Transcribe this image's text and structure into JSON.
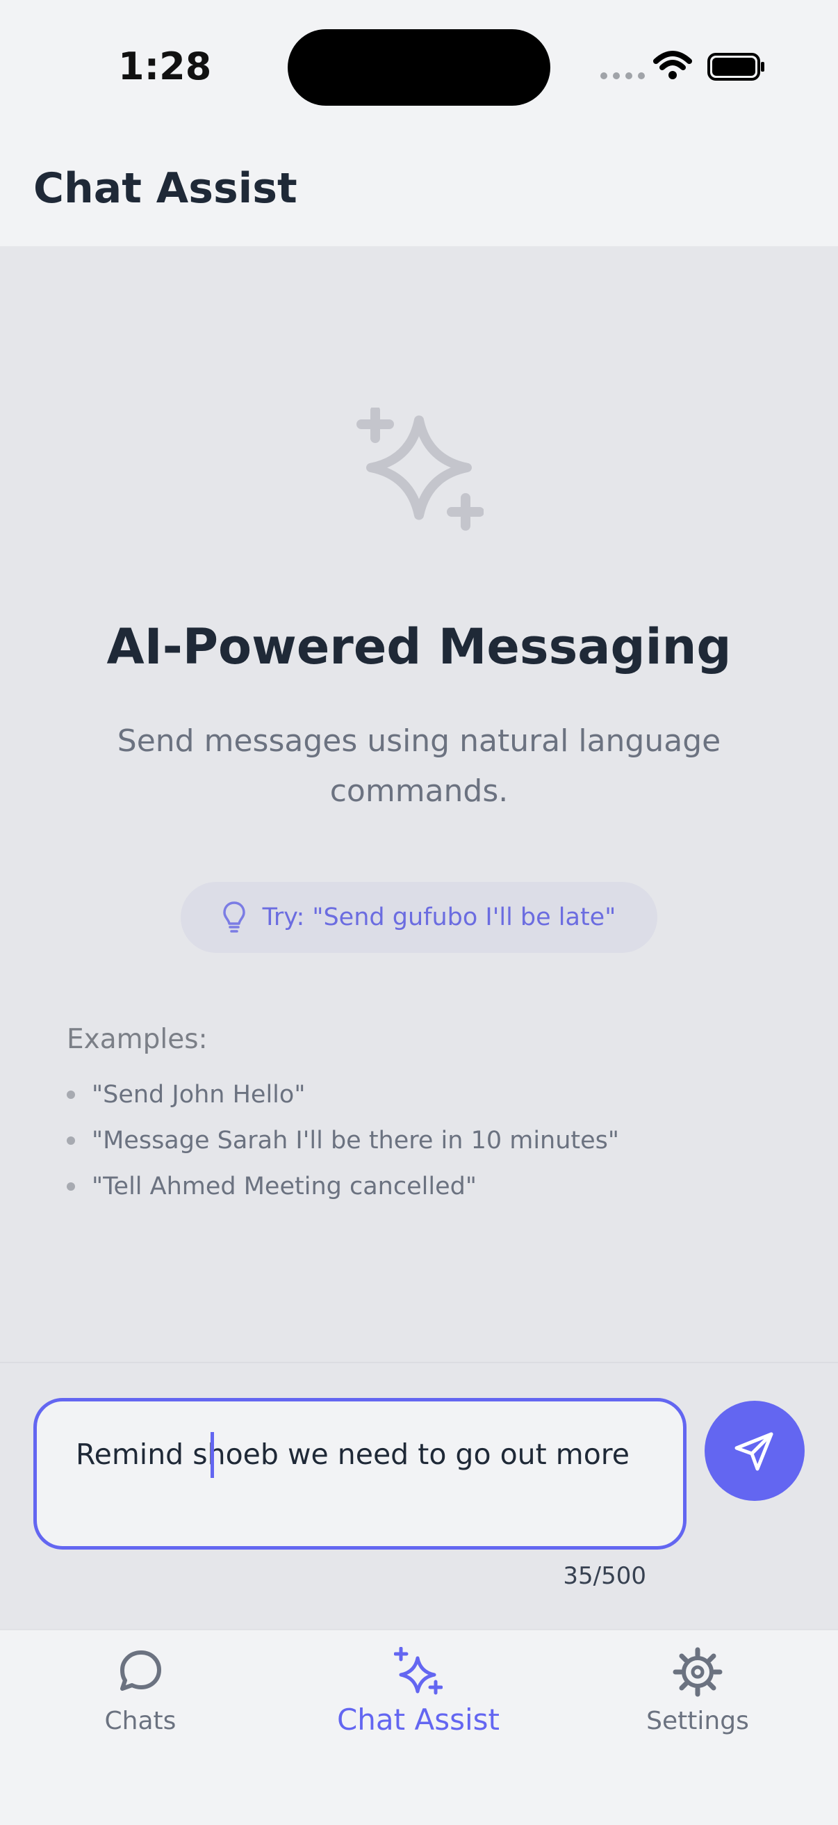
{
  "status_bar": {
    "time": "1:28"
  },
  "header": {
    "title": "Chat Assist"
  },
  "hero": {
    "icon": "sparkles-icon",
    "title": "AI-Powered Messaging",
    "subtitle": "Send messages using natural language commands."
  },
  "tip": {
    "icon": "lightbulb-icon",
    "text": "Try: \"Send gufubo I'll be late\""
  },
  "examples": {
    "title": "Examples:",
    "items": [
      "\"Send John Hello\"",
      "\"Message Sarah I'll be there in 10 minutes\"",
      "\"Tell Ahmed Meeting cancelled\""
    ]
  },
  "composer": {
    "value": "Remind shoeb we need to go out more",
    "counter": "35/500",
    "send_icon": "send-icon"
  },
  "tabs": [
    {
      "label": "Chats",
      "icon": "chat-bubble-icon"
    },
    {
      "label": "Chat Assist",
      "icon": "sparkles-icon",
      "active": true
    },
    {
      "label": "Settings",
      "icon": "gear-icon"
    }
  ],
  "colors": {
    "accent": "#6366f1",
    "background": "#e5e6ea",
    "header_bg": "#f2f3f5",
    "muted_icon": "#c4c5cc"
  }
}
